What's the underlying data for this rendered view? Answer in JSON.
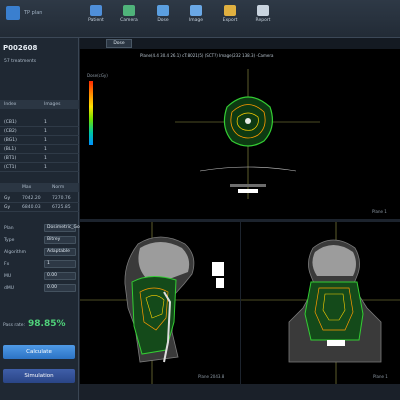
{
  "app": {
    "title": "TP plan"
  },
  "toolbar": {
    "items": [
      {
        "label": "Patient",
        "icon": "patient-icon",
        "color": "#4f8fd9"
      },
      {
        "label": "Camera",
        "icon": "camera-icon",
        "color": "#4fb37a"
      },
      {
        "label": "Dose",
        "icon": "dose-icon",
        "color": "#5b9fe0"
      },
      {
        "label": "Image",
        "icon": "image-icon",
        "color": "#6aa8e6"
      },
      {
        "label": "Export",
        "icon": "folder-icon",
        "color": "#e0b040"
      },
      {
        "label": "Report",
        "icon": "report-icon",
        "color": "#c9d4df"
      }
    ]
  },
  "sidebar": {
    "patient_id": "P002608",
    "treatment": "57 treatments",
    "structures_header": [
      "Index",
      "Images"
    ],
    "structures": [
      {
        "index": "(CB1)",
        "value": "1"
      },
      {
        "index": "(CB2)",
        "value": "1"
      },
      {
        "index": "(BG1)",
        "value": "1"
      },
      {
        "index": "(BL1)",
        "value": "1"
      },
      {
        "index": "(BT1)",
        "value": "1"
      },
      {
        "index": "(CT1)",
        "value": "1"
      }
    ],
    "dose_header": [
      "Max",
      "Norm"
    ],
    "dose_rows": [
      {
        "label": "Gy",
        "max": "7042.20",
        "norm": "7270.76"
      },
      {
        "label": "Gy",
        "max": "6840.03",
        "norm": "6725.85"
      }
    ],
    "settings": [
      {
        "label": "Plan",
        "value": "Dosimetric_Gold_V4"
      },
      {
        "label": "Type",
        "value": "Bitrey"
      },
      {
        "label": "Algorithm",
        "value": "Adaptable"
      },
      {
        "label": "Fx",
        "value": "1"
      },
      {
        "label": "MU",
        "value": "0.00"
      },
      {
        "label": "dMU",
        "value": "0.00"
      }
    ],
    "pass_rate_label": "Pass rate:",
    "pass_rate": "98.85%",
    "calc_button": "Calculate",
    "sim_button": "Simulation"
  },
  "viewer": {
    "tab": "Dose",
    "axial_info": "Plane(4.4 30.4 26.1) cT:8021(5)  (SCT?)  Image(232 138.3) -Camera",
    "axial_tag": "Plane 1",
    "sagittal_tag": "Plane 2043.8",
    "coronal_tag": "Plane 1",
    "colorbar_label": "Dose(cGy)",
    "colorbar_colors": [
      "#ff2a00",
      "#ff8a00",
      "#ffe000",
      "#6fe000",
      "#00c8a0",
      "#0090ff"
    ]
  }
}
